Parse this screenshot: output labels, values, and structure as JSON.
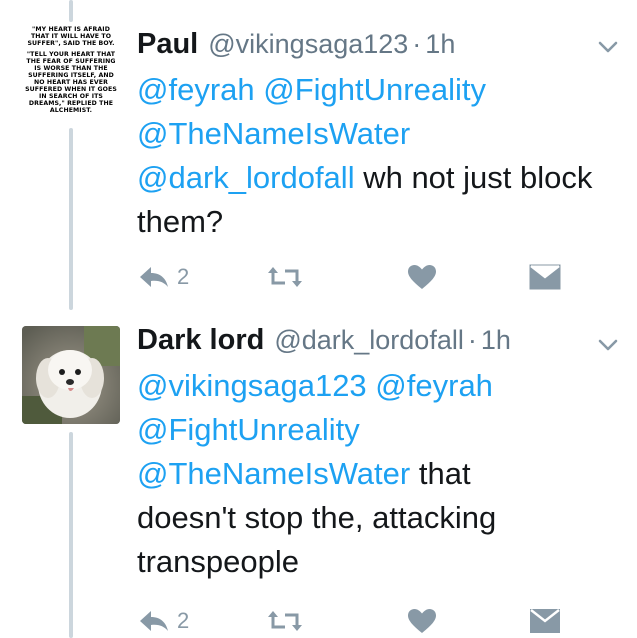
{
  "tweets": [
    {
      "name": "Paul",
      "handle": "@vikingsaga123",
      "separator": "·",
      "time": "1h",
      "avatar": {
        "type": "quote-image",
        "quote_lines": [
          "\"My heart is afraid that it will have to suffer\", said the boy.",
          "\"Tell your heart that the fear of suffering is worse than the suffering itself, and no heart has ever suffered when it goes in search of its dreams,\" replied the alchemist."
        ]
      },
      "mentions": [
        "@feyrah",
        "@FightUnreality",
        "@TheNameIsWater",
        "@dark_lordofall"
      ],
      "text": "wh not just block them?",
      "reply_count": "2",
      "actions": [
        "reply-icon",
        "retweet-icon",
        "like-icon",
        "dm-icon"
      ]
    },
    {
      "name": "Dark lord",
      "handle": "@dark_lordofall",
      "separator": "·",
      "time": "1h",
      "avatar": {
        "type": "photo",
        "subject": "white fluffy puppy"
      },
      "mentions": [
        "@vikingsaga123",
        "@feyrah",
        "@FightUnreality",
        "@TheNameIsWater"
      ],
      "text_line1": "that",
      "text_line2": "doesn't stop the, attacking",
      "text_line3": "transpeople",
      "reply_count": "2",
      "actions": [
        "reply-icon",
        "retweet-icon",
        "like-icon",
        "dm-icon"
      ]
    }
  ],
  "colors": {
    "link": "#1da1f2",
    "icon": "#8899a6",
    "secondary_text": "#657786",
    "thread_line": "#ccd6dd"
  }
}
